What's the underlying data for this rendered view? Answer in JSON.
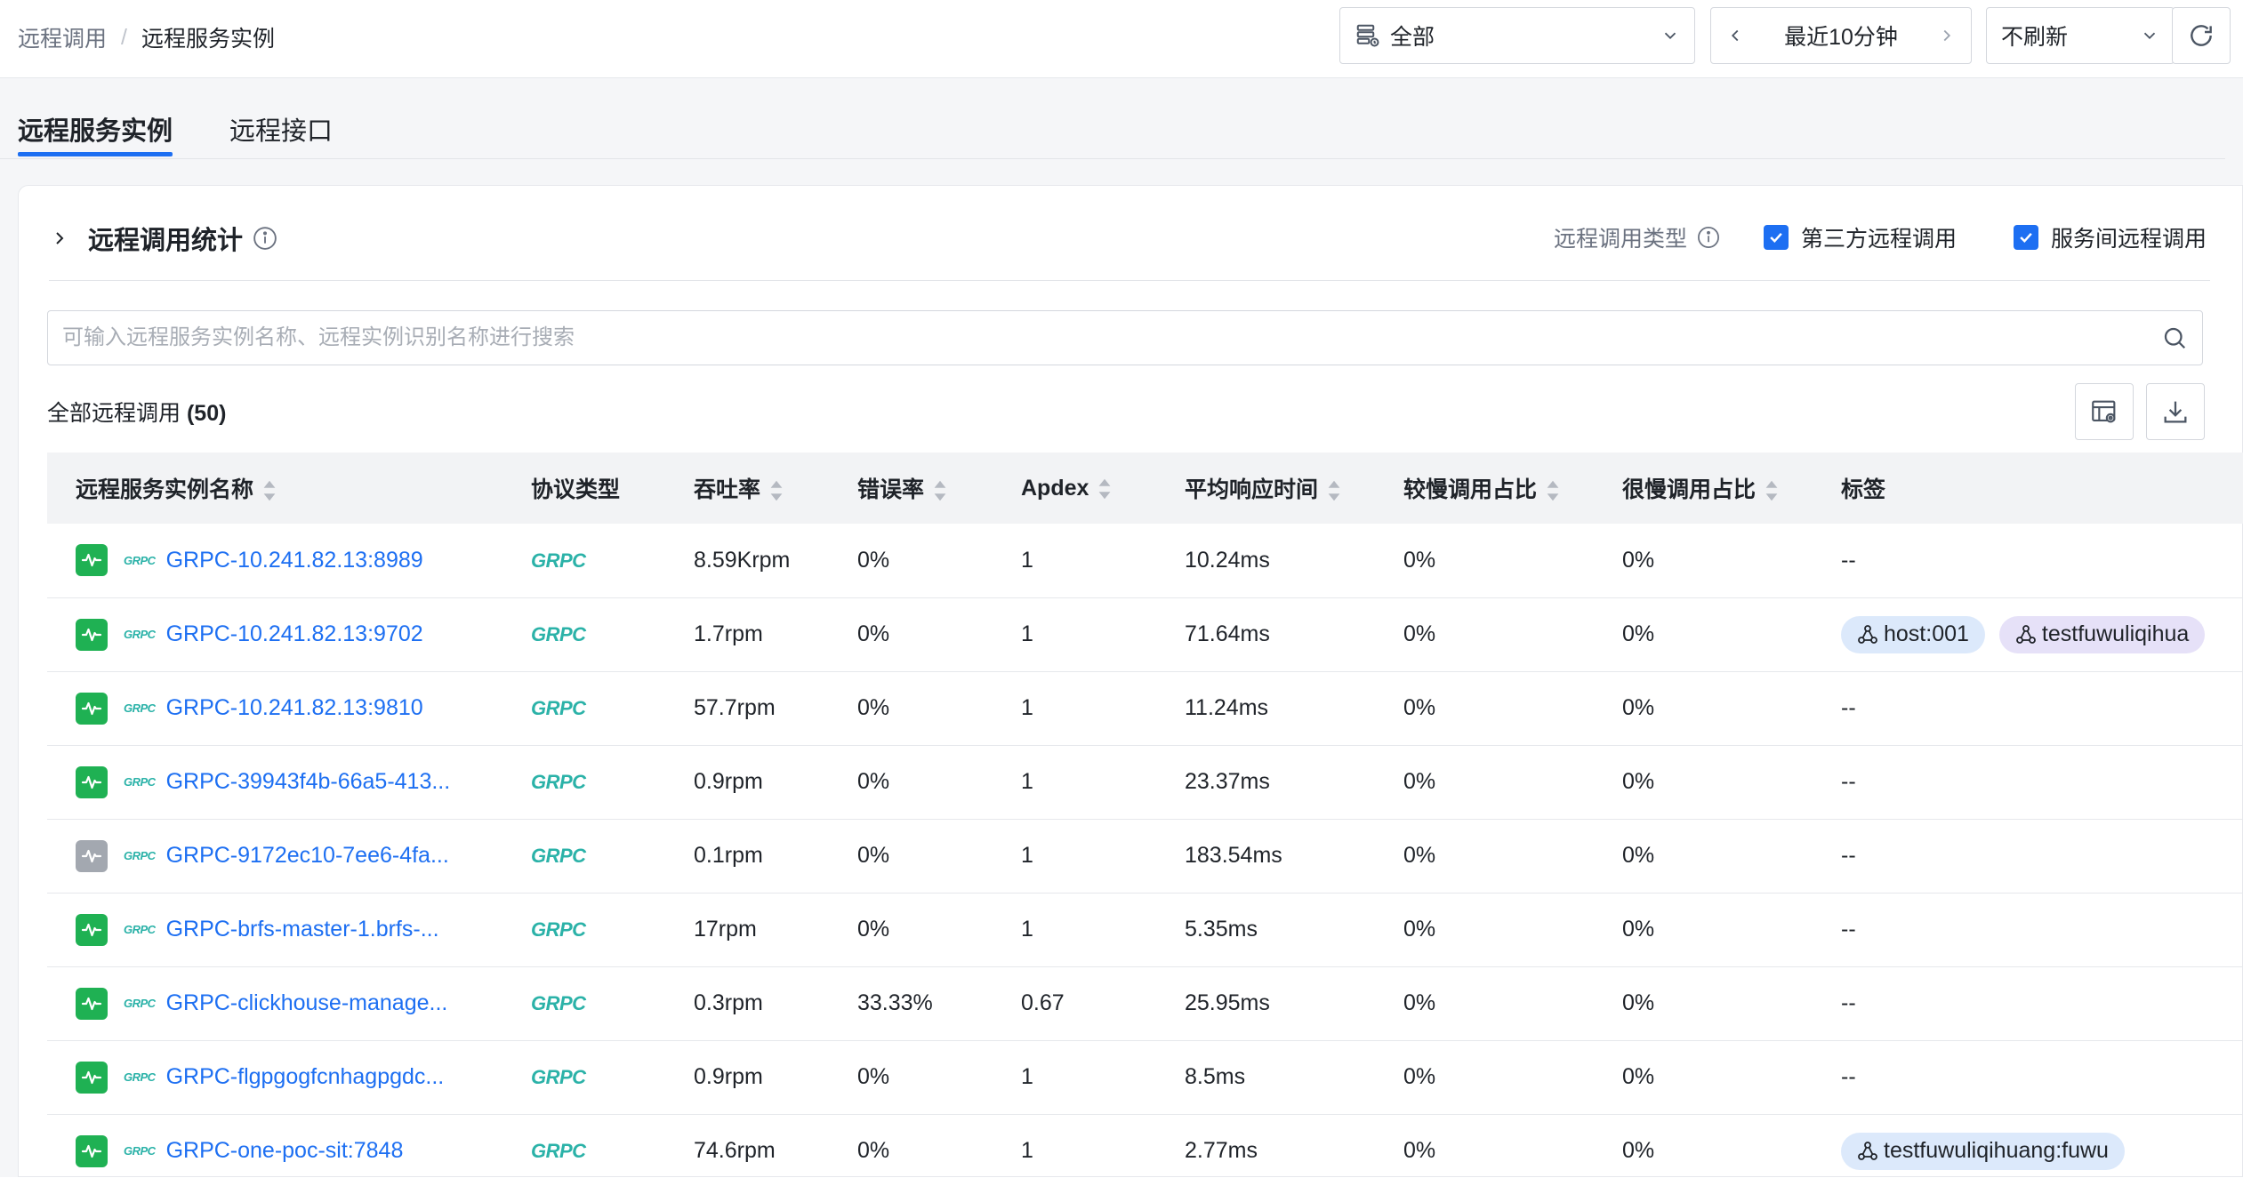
{
  "breadcrumb": {
    "parent": "远程调用",
    "separator": "/",
    "current": "远程服务实例"
  },
  "toolbar": {
    "scope": "全部",
    "time_range": "最近10分钟",
    "refresh": "不刷新"
  },
  "tabs": [
    {
      "label": "远程服务实例",
      "active": true
    },
    {
      "label": "远程接口",
      "active": false
    }
  ],
  "card": {
    "title": "远程调用统计",
    "filter_title": "远程调用类型",
    "filters": [
      {
        "label": "第三方远程调用",
        "checked": true
      },
      {
        "label": "服务间远程调用",
        "checked": true
      }
    ],
    "search_placeholder": "可输入远程服务实例名称、远程实例识别名称进行搜索",
    "count_label": "全部远程调用",
    "count_value": "(50)"
  },
  "table": {
    "columns": [
      "远程服务实例名称",
      "协议类型",
      "吞吐率",
      "错误率",
      "Apdex",
      "平均响应时间",
      "较慢调用占比",
      "很慢调用占比",
      "标签"
    ],
    "protocol_mini": "GRPC",
    "protocol_logo": "GRPC",
    "rows": [
      {
        "status": "green",
        "name": "GRPC-10.241.82.13:8989",
        "throughput": "8.59Krpm",
        "error": "0%",
        "apdex": "1",
        "avg": "10.24ms",
        "slow": "0%",
        "very_slow": "0%",
        "tags": []
      },
      {
        "status": "green",
        "name": "GRPC-10.241.82.13:9702",
        "throughput": "1.7rpm",
        "error": "0%",
        "apdex": "1",
        "avg": "71.64ms",
        "slow": "0%",
        "very_slow": "0%",
        "tags": [
          {
            "text": "host:001",
            "color": "blue"
          },
          {
            "text": "testfuwuliqihua",
            "color": "purple"
          }
        ]
      },
      {
        "status": "green",
        "name": "GRPC-10.241.82.13:9810",
        "throughput": "57.7rpm",
        "error": "0%",
        "apdex": "1",
        "avg": "11.24ms",
        "slow": "0%",
        "very_slow": "0%",
        "tags": []
      },
      {
        "status": "green",
        "name": "GRPC-39943f4b-66a5-413...",
        "throughput": "0.9rpm",
        "error": "0%",
        "apdex": "1",
        "avg": "23.37ms",
        "slow": "0%",
        "very_slow": "0%",
        "tags": []
      },
      {
        "status": "gray",
        "name": "GRPC-9172ec10-7ee6-4fa...",
        "throughput": "0.1rpm",
        "error": "0%",
        "apdex": "1",
        "avg": "183.54ms",
        "slow": "0%",
        "very_slow": "0%",
        "tags": []
      },
      {
        "status": "green",
        "name": "GRPC-brfs-master-1.brfs-...",
        "throughput": "17rpm",
        "error": "0%",
        "apdex": "1",
        "avg": "5.35ms",
        "slow": "0%",
        "very_slow": "0%",
        "tags": []
      },
      {
        "status": "green",
        "name": "GRPC-clickhouse-manage...",
        "throughput": "0.3rpm",
        "error": "33.33%",
        "apdex": "0.67",
        "avg": "25.95ms",
        "slow": "0%",
        "very_slow": "0%",
        "tags": []
      },
      {
        "status": "green",
        "name": "GRPC-flgpgogfcnhagpgdc...",
        "throughput": "0.9rpm",
        "error": "0%",
        "apdex": "1",
        "avg": "8.5ms",
        "slow": "0%",
        "very_slow": "0%",
        "tags": []
      },
      {
        "status": "green",
        "name": "GRPC-one-poc-sit:7848",
        "throughput": "74.6rpm",
        "error": "0%",
        "apdex": "1",
        "avg": "2.77ms",
        "slow": "0%",
        "very_slow": "0%",
        "tags": [
          {
            "text": "testfuwuliqihuang:fuwu",
            "color": "blue"
          }
        ]
      }
    ],
    "empty_tag": "--"
  },
  "icons": {
    "scope": "database-icon",
    "status": "activity-pulse-icon",
    "tag": "cluster-icon",
    "sort": "sort-icon"
  },
  "colors": {
    "accent": "#1d6ff2",
    "status_green": "#1fb153",
    "status_gray": "#a3a8b0",
    "grpc": "#2bb2a8",
    "tag_blue": "#dce9fb",
    "tag_purple": "#e6e1f8"
  }
}
